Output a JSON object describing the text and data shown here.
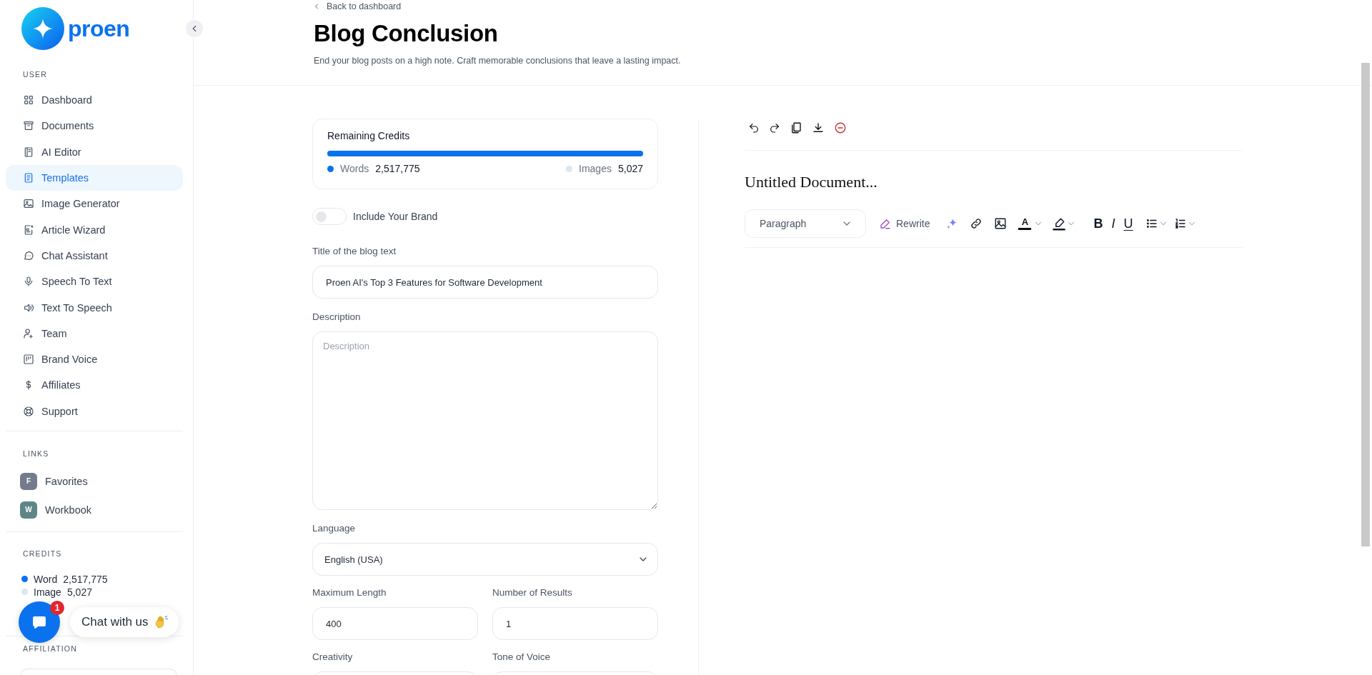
{
  "sidebar": {
    "logo": "proen",
    "user": {
      "heading": "USER",
      "items": [
        {
          "label": "Dashboard",
          "selected": false
        },
        {
          "label": "Documents",
          "selected": false
        },
        {
          "label": "AI Editor",
          "selected": false
        },
        {
          "label": "Templates",
          "selected": true
        },
        {
          "label": "Image Generator",
          "selected": false
        },
        {
          "label": "Article Wizard",
          "selected": false
        },
        {
          "label": "Chat Assistant",
          "selected": false
        },
        {
          "label": "Speech To Text",
          "selected": false
        },
        {
          "label": "Text To Speech",
          "selected": false
        },
        {
          "label": "Team",
          "selected": false
        },
        {
          "label": "Brand Voice",
          "selected": false
        },
        {
          "label": "Affiliates",
          "selected": false
        },
        {
          "label": "Support",
          "selected": false
        }
      ]
    },
    "links": {
      "heading": "LINKS",
      "items": [
        {
          "initial": "F",
          "label": "Favorites",
          "color": "#737b8c"
        },
        {
          "initial": "W",
          "label": "Workbook",
          "color": "#5e8687"
        }
      ]
    },
    "credits": {
      "heading": "CREDITS",
      "items": [
        {
          "label": "Word",
          "value": "2,517,775",
          "color": "#0a72ef"
        },
        {
          "label": "Image",
          "value": "5,027",
          "color": "#dbe6f5"
        }
      ]
    },
    "affiliation": {
      "heading": "AFFILIATION"
    }
  },
  "header": {
    "back": "Back to dashboard",
    "title": "Blog Conclusion",
    "subtitle": "End your blog posts on a high note. Craft memorable conclusions that leave a lasting impact."
  },
  "form": {
    "credits_card": {
      "title": "Remaining Credits",
      "level": 1,
      "items": [
        {
          "label": "Words",
          "value": "2,517,775",
          "color": "#0a72ef"
        },
        {
          "label": "Images",
          "value": "5,027",
          "color": "#dbe6f5"
        }
      ]
    },
    "brand_toggle": {
      "label": "Include Your Brand",
      "on": false
    },
    "fields": [
      {
        "kind": "text",
        "label": "Title of the blog text",
        "value": "Proen AI's Top 3 Features for Software Development"
      },
      {
        "kind": "textarea",
        "label": "Description",
        "placeholder": "Description"
      },
      {
        "kind": "select",
        "label": "Language",
        "value": "English (USA)"
      }
    ],
    "field_pairs": [
      [
        {
          "label": "Maximum Length",
          "value": "400"
        },
        {
          "label": "Number of Results",
          "value": "1"
        }
      ],
      [
        {
          "label": "Creativity"
        },
        {
          "label": "Tone of Voice"
        }
      ]
    ]
  },
  "editor": {
    "document_title": "Untitled Document...",
    "block_style": "Paragraph",
    "rewrite": "Rewrite",
    "text_color": "A",
    "format_buttons": [
      {
        "kind": "bold",
        "label": "B"
      },
      {
        "kind": "italic",
        "label": "I"
      },
      {
        "kind": "underline",
        "label": "U"
      }
    ]
  },
  "chat": {
    "badge": "1",
    "label": "Chat with us"
  }
}
